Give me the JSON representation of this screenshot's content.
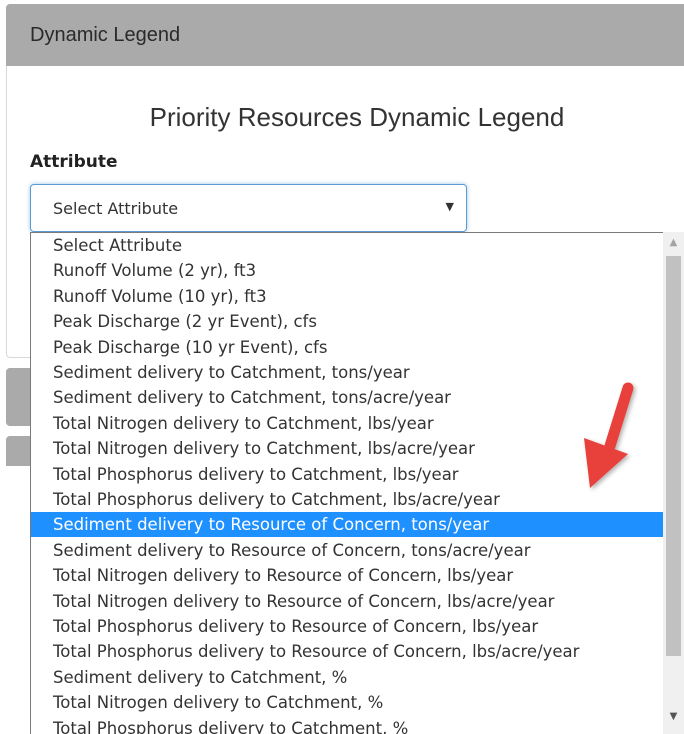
{
  "panel": {
    "header_title": "Dynamic Legend",
    "legend_heading": "Priority Resources Dynamic Legend",
    "attribute_label": "Attribute"
  },
  "select": {
    "value": "Select Attribute",
    "arrow_glyph": "▼"
  },
  "dropdown": {
    "selected_index": 11,
    "options": [
      "Select Attribute",
      "Runoff Volume (2 yr), ft3",
      "Runoff Volume (10 yr), ft3",
      "Peak Discharge (2 yr Event), cfs",
      "Peak Discharge (10 yr Event), cfs",
      "Sediment delivery to Catchment, tons/year",
      "Sediment delivery to Catchment, tons/acre/year",
      "Total Nitrogen delivery to Catchment, lbs/year",
      "Total Nitrogen delivery to Catchment, lbs/acre/year",
      "Total Phosphorus delivery to Catchment, lbs/year",
      "Total Phosphorus delivery to Catchment, lbs/acre/year",
      "Sediment delivery to Resource of Concern, tons/year",
      "Sediment delivery to Resource of Concern, tons/acre/year",
      "Total Nitrogen delivery to Resource of Concern, lbs/year",
      "Total Nitrogen delivery to Resource of Concern, lbs/acre/year",
      "Total Phosphorus delivery to Resource of Concern, lbs/year",
      "Total Phosphorus delivery to Resource of Concern, lbs/acre/year",
      "Sediment delivery to Catchment, %",
      "Total Nitrogen delivery to Catchment, %",
      "Total Phosphorus delivery to Catchment, %"
    ]
  },
  "scrollbar": {
    "up_glyph": "▲",
    "down_glyph": "▼"
  },
  "colors": {
    "header_bg": "#aaaaaa",
    "selected_bg": "#1e90ff",
    "focus_border": "#5b9bd5",
    "annotation_arrow": "#e8413a"
  }
}
